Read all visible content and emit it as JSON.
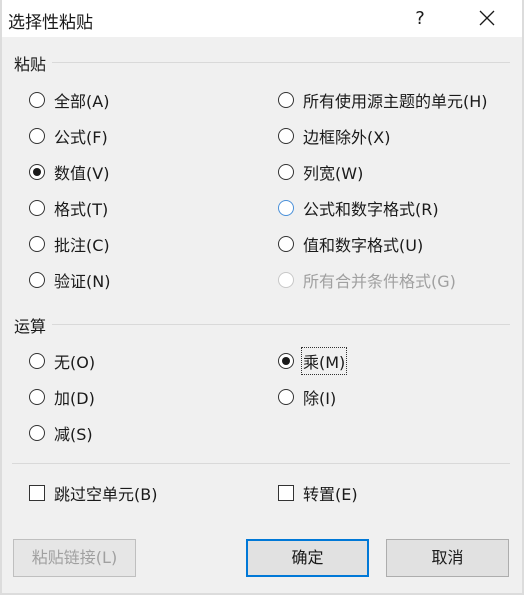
{
  "window": {
    "title": "选择性粘贴",
    "help_glyph": "?"
  },
  "paste_section": {
    "title": "粘贴",
    "left_options": [
      "全部(A)",
      "公式(F)",
      "数值(V)",
      "格式(T)",
      "批注(C)",
      "验证(N)"
    ],
    "right_options": [
      "所有使用源主题的单元(H)",
      "边框除外(X)",
      "列宽(W)",
      "公式和数字格式(R)",
      "值和数字格式(U)",
      "所有合并条件格式(G)"
    ],
    "selected": "数值(V)"
  },
  "operation_section": {
    "title": "运算",
    "options": [
      "无(O)",
      "加(D)",
      "减(S)",
      "乘(M)",
      "除(I)"
    ],
    "selected": "乘(M)"
  },
  "checkboxes": {
    "skip_blanks": "跳过空单元(B)",
    "transpose": "转置(E)"
  },
  "buttons": {
    "paste_link": "粘贴链接(L)",
    "ok": "确定",
    "cancel": "取消"
  }
}
